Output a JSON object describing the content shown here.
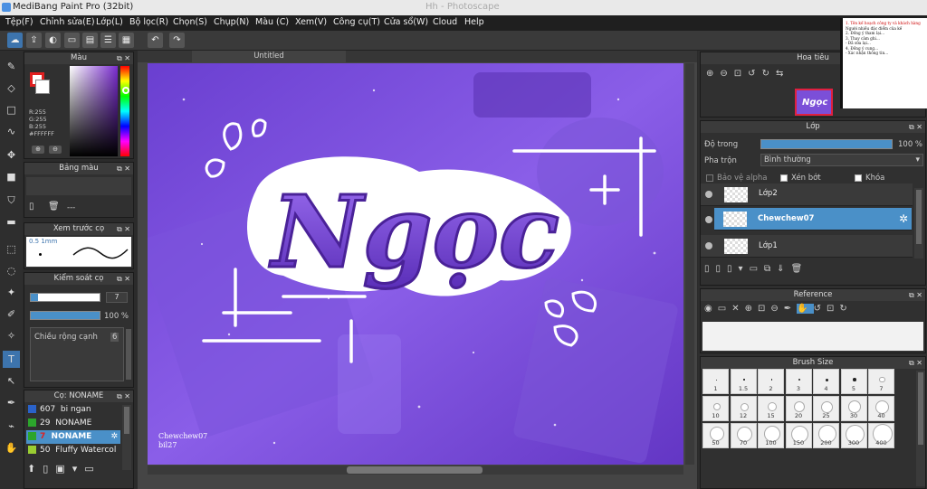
{
  "window": {
    "title": "MediBang Paint Pro (32bit)"
  },
  "menu": [
    "Tệp(F)",
    "Chỉnh sửa(E)",
    "Lớp(L)",
    "Bộ lọc(R)",
    "Chọn(S)",
    "Chụp(N)",
    "Màu (C)",
    "Xem(V)",
    "Công cụ(T)",
    "Cửa sổ(W)",
    "Cloud",
    "Help"
  ],
  "color_panel": {
    "title": "Màu",
    "r": "R:255",
    "g": "G:255",
    "b": "B:255",
    "hex": "#FFFFFF"
  },
  "palette_panel": {
    "title": "Bảng màu",
    "value": "---"
  },
  "preview_panel": {
    "title": "Xem trước cọ",
    "size": "0.5 1mm"
  },
  "brush_control": {
    "title": "Kiểm soát cọ",
    "size_value": "7",
    "opacity_value": "100 %",
    "width_label": "Chiều rộng cạnh",
    "width_value": "6"
  },
  "brush_list": {
    "title": "Cọ: NONAME",
    "items": [
      {
        "num": "607",
        "name": "bi ngan",
        "color": "#2a62c9"
      },
      {
        "num": "29",
        "name": "NONAME",
        "color": "#2ca52c"
      },
      {
        "num": "7",
        "name": "NONAME",
        "color": "#2ca52c"
      },
      {
        "num": "50",
        "name": "Fluffy Watercol",
        "color": "#9acd32"
      }
    ]
  },
  "canvas": {
    "tab": "Untitled",
    "artwork_text": "Ngọc",
    "signature_line1": "Chewchew07",
    "signature_line2": "bil27"
  },
  "navigator": {
    "title": "Hoa tiêu"
  },
  "layer_panel": {
    "title": "Lớp",
    "opacity_label": "Độ trong",
    "opacity_value": "100 %",
    "blend_label": "Pha trộn",
    "blend_value": "Bình thường",
    "protect_alpha": "Bảo vệ alpha",
    "clipping": "Xén bớt",
    "lock": "Khóa",
    "layers": [
      {
        "name": "Lớp2",
        "selected": false
      },
      {
        "name": "Chewchew07",
        "selected": true
      },
      {
        "name": "Lớp1",
        "selected": false
      }
    ]
  },
  "reference_panel": {
    "title": "Reference"
  },
  "brush_size_panel": {
    "title": "Brush Size",
    "sizes": [
      "1",
      "1.5",
      "2",
      "3",
      "4",
      "5",
      "7",
      "10",
      "12",
      "15",
      "20",
      "25",
      "30",
      "40",
      "50",
      "70",
      "100",
      "150",
      "200",
      "300",
      "400"
    ]
  },
  "external_window": {
    "lines": [
      "1. Tên kế hoạch công ty và khách hàng",
      "Người nhiều đặc điểm của kế",
      "2. Đồng ý tham lại...",
      "3. Thay cảm ghi...",
      "- Đã sửa lại...",
      "4. Đồng ý cung...",
      "- Xác nhận thông tin..."
    ]
  }
}
